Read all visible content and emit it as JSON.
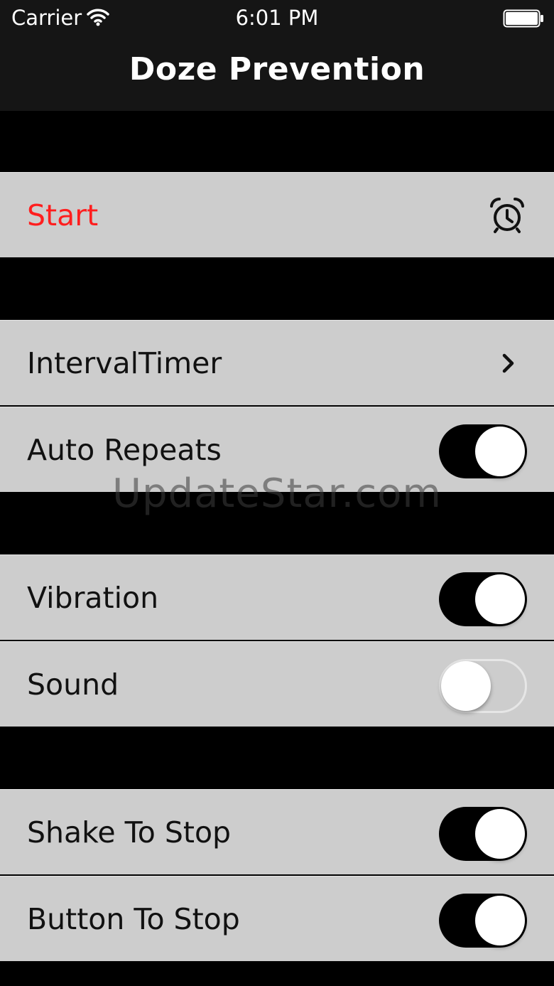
{
  "status_bar": {
    "carrier": "Carrier",
    "time": "6:01 PM",
    "wifi_icon": "wifi-icon",
    "battery_icon": "battery-full-icon"
  },
  "nav": {
    "title": "Doze Prevention"
  },
  "start": {
    "label": "Start",
    "icon": "alarm-clock-icon",
    "color": "#ff1e1e"
  },
  "settings": {
    "interval_timer": {
      "label": "IntervalTimer",
      "icon": "chevron-right-icon"
    },
    "auto_repeats": {
      "label": "Auto Repeats",
      "on": true
    },
    "vibration": {
      "label": "Vibration",
      "on": true
    },
    "sound": {
      "label": "Sound",
      "on": false
    },
    "shake_to_stop": {
      "label": "Shake To Stop",
      "on": true
    },
    "button_to_stop": {
      "label": "Button To Stop",
      "on": true
    }
  },
  "watermark": "UpdateStar.com",
  "colors": {
    "background": "#000000",
    "bar": "#151515",
    "cell": "#cdcdcd",
    "separator": "#e6e6e6",
    "accent": "#ff1e1e"
  }
}
